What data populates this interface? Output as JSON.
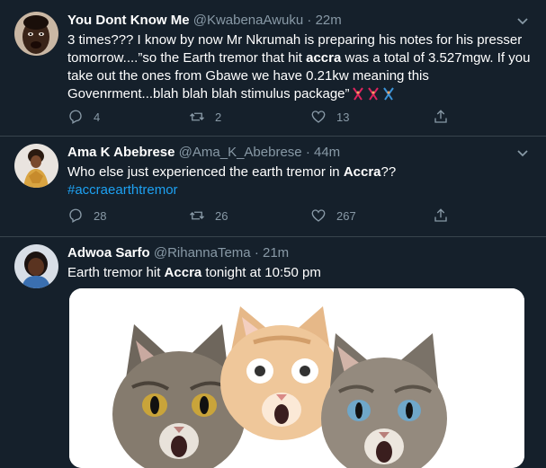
{
  "tweets": [
    {
      "name": "You Dont Know Me",
      "handle": "@KwabenaAwuku",
      "sep": "·",
      "time": "22m",
      "text_pre": "3 times??? I know by now Mr Nkrumah is preparing his notes for his presser tomorrow....”so the Earth tremor that hit ",
      "text_bold": "accra",
      "text_post": " was a total of 3.527mgw. If you take out the ones from Gbawe we have 0.21kw meaning this Govenrment...blah blah blah stimulus package”",
      "replies": "4",
      "retweets": "2",
      "likes": "13"
    },
    {
      "name": "Ama K Abebrese",
      "handle": "@Ama_K_Abebrese",
      "sep": "·",
      "time": "44m",
      "text_pre": "Who else just experienced the earth tremor in ",
      "text_bold": "Accra",
      "text_post": "??",
      "hashtag": "#accraearthtremor",
      "replies": "28",
      "retweets": "26",
      "likes": "267"
    },
    {
      "name": "Adwoa Sarfo",
      "handle": "@RihannaTema",
      "sep": "·",
      "time": "21m",
      "text_pre": "Earth tremor hit ",
      "text_bold": "Accra",
      "text_post": " tonight at 10:50 pm"
    }
  ],
  "colors": {
    "background": "#15202b",
    "border": "#38444d",
    "secondary_text": "#8899a6",
    "link": "#1da1f2"
  },
  "icons": [
    "reply-icon",
    "retweet-icon",
    "like-icon",
    "share-icon",
    "caret-down-icon",
    "dancing-emoji-icon"
  ]
}
